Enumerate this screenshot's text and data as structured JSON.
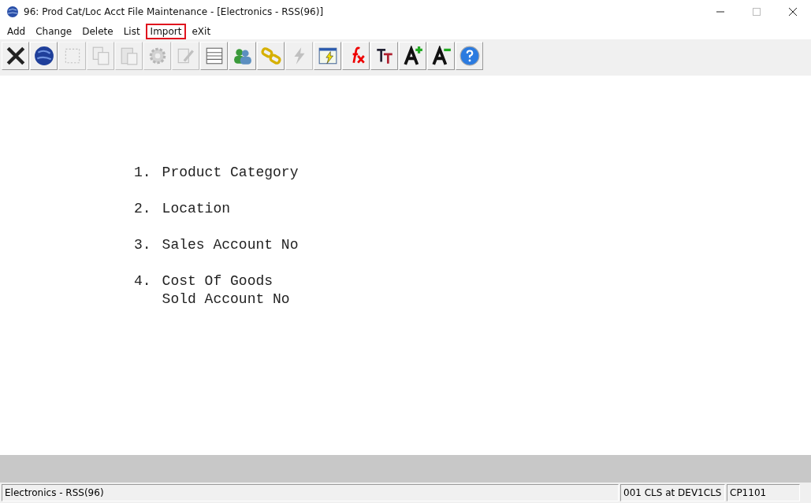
{
  "window": {
    "title": "96: Prod Cat/Loc Acct File Maintenance - [Electronics - RSS(96)]"
  },
  "menu": [
    {
      "label": "Add",
      "highlighted": false
    },
    {
      "label": "Change",
      "highlighted": false
    },
    {
      "label": "Delete",
      "highlighted": false
    },
    {
      "label": "List",
      "highlighted": false
    },
    {
      "label": "Import",
      "highlighted": true
    },
    {
      "label": "eXit",
      "highlighted": false
    }
  ],
  "toolbar": [
    {
      "kind": "close",
      "disabled": false
    },
    {
      "kind": "globe",
      "disabled": false
    },
    {
      "kind": "select",
      "disabled": true
    },
    {
      "kind": "copy",
      "disabled": true
    },
    {
      "kind": "paste",
      "disabled": true
    },
    {
      "kind": "gear",
      "disabled": true
    },
    {
      "kind": "edit",
      "disabled": true
    },
    {
      "kind": "table",
      "disabled": false
    },
    {
      "kind": "users",
      "disabled": false
    },
    {
      "kind": "link",
      "disabled": false
    },
    {
      "kind": "lightning",
      "disabled": true
    },
    {
      "kind": "window",
      "disabled": false
    },
    {
      "kind": "fx",
      "disabled": false
    },
    {
      "kind": "font",
      "disabled": false
    },
    {
      "kind": "font-up",
      "disabled": false
    },
    {
      "kind": "font-down",
      "disabled": false
    },
    {
      "kind": "help",
      "disabled": false
    }
  ],
  "fields": [
    {
      "number": "1.",
      "lines": [
        "Product Category"
      ]
    },
    {
      "number": "2.",
      "lines": [
        "Location"
      ]
    },
    {
      "number": "3.",
      "lines": [
        "Sales Account No"
      ]
    },
    {
      "number": "4.",
      "lines": [
        "Cost Of Goods",
        "Sold Account No"
      ]
    }
  ],
  "status_bar": [
    "Electronics - RSS(96)",
    "001 CLS at DEV1CLS",
    "CP1101"
  ]
}
